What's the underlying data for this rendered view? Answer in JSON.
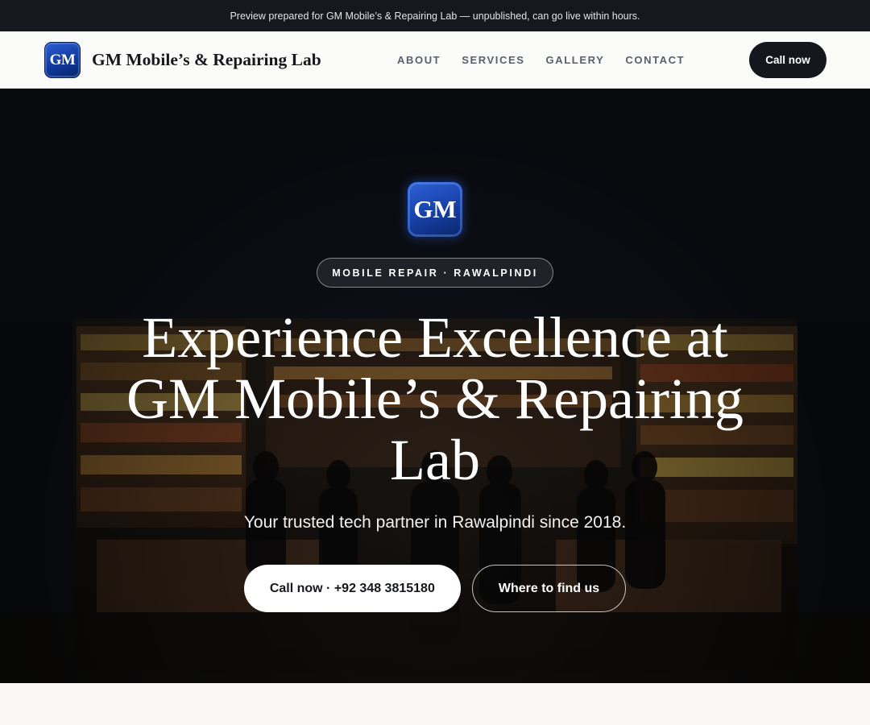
{
  "preview_banner": "Preview prepared for GM Mobile’s & Repairing Lab — unpublished, can go live within hours.",
  "header": {
    "logo_text": "GM",
    "brand_name": "GM Mobile’s & Repairing Lab",
    "nav": [
      "ABOUT",
      "SERVICES",
      "GALLERY",
      "CONTACT"
    ],
    "call_label": "Call now"
  },
  "hero": {
    "logo_text": "GM",
    "tag": "MOBILE REPAIR · RAWALPINDI",
    "title_line1": "Experience Excellence at",
    "title_line2": "GM Mobile’s & Repairing",
    "title_line3": "Lab",
    "subtitle": "Your trusted tech partner in Rawalpindi since 2018.",
    "primary_cta": "Call now · +92 348 3815180",
    "secondary_cta": "Where to find us"
  },
  "colors": {
    "topbar_bg": "#16181d",
    "logo_blue": "#163fa6",
    "button_dark": "#15171c",
    "page_bg": "#f9f8f5"
  }
}
